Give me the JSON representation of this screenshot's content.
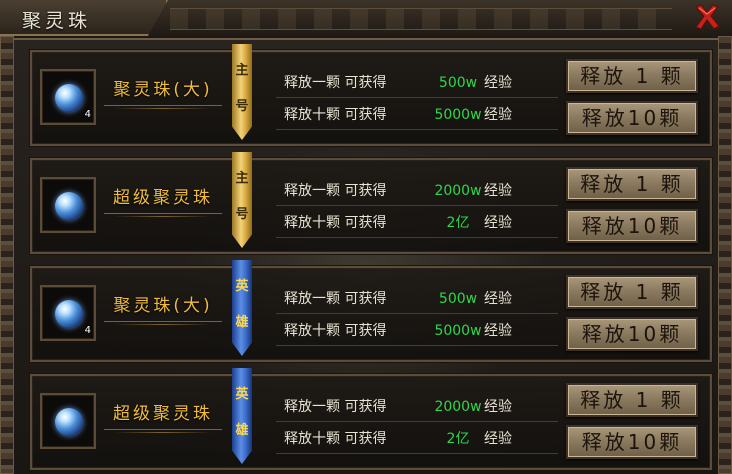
{
  "window": {
    "title": "聚灵珠",
    "close_icon": "close-x-icon",
    "colors": {
      "accent_gold": "#f0bd3c",
      "amount_green": "#2cd74b",
      "button": "#8c7b60"
    }
  },
  "rows": [
    {
      "name": "聚灵珠(大)",
      "icon": "spirit-orb-icon",
      "count": "4",
      "tag": [
        "主",
        "号"
      ],
      "tag_color": "gold",
      "lines": [
        {
          "text": "释放一颗 可获得",
          "amount": "500w",
          "unit": "经验"
        },
        {
          "text": "释放十颗 可获得",
          "amount": "5000w",
          "unit": "经验"
        }
      ],
      "buttons": [
        "释放 1 颗",
        "释放10颗"
      ]
    },
    {
      "name": "超级聚灵珠",
      "icon": "spirit-orb-icon",
      "count": "",
      "tag": [
        "主",
        "号"
      ],
      "tag_color": "gold",
      "lines": [
        {
          "text": "释放一颗 可获得",
          "amount": "2000w",
          "unit": "经验"
        },
        {
          "text": "释放十颗 可获得",
          "amount": "2亿",
          "unit": "经验"
        }
      ],
      "buttons": [
        "释放 1 颗",
        "释放10颗"
      ]
    },
    {
      "name": "聚灵珠(大)",
      "icon": "spirit-orb-icon",
      "count": "4",
      "tag": [
        "英",
        "雄"
      ],
      "tag_color": "blue",
      "lines": [
        {
          "text": "释放一颗 可获得",
          "amount": "500w",
          "unit": "经验"
        },
        {
          "text": "释放十颗 可获得",
          "amount": "5000w",
          "unit": "经验"
        }
      ],
      "buttons": [
        "释放 1 颗",
        "释放10颗"
      ]
    },
    {
      "name": "超级聚灵珠",
      "icon": "spirit-orb-icon",
      "count": "",
      "tag": [
        "英",
        "雄"
      ],
      "tag_color": "blue",
      "lines": [
        {
          "text": "释放一颗 可获得",
          "amount": "2000w",
          "unit": "经验"
        },
        {
          "text": "释放十颗 可获得",
          "amount": "2亿",
          "unit": "经验"
        }
      ],
      "buttons": [
        "释放 1 颗",
        "释放10颗"
      ]
    }
  ]
}
